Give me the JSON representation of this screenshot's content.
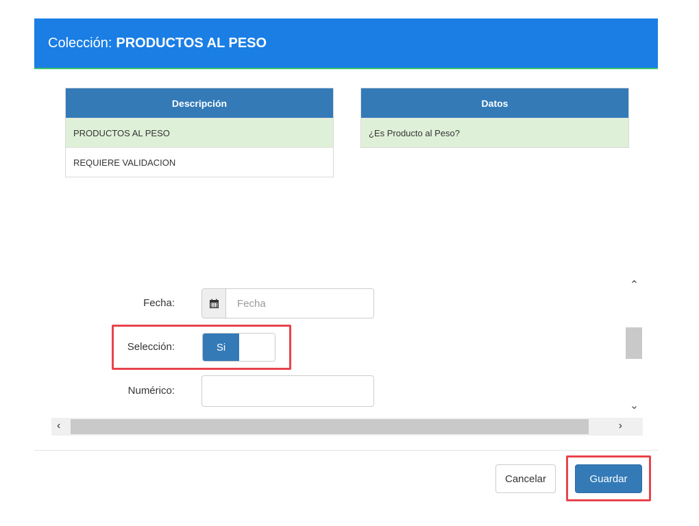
{
  "header": {
    "title_prefix": "Colección:",
    "title_name": "PRODUCTOS AL PESO"
  },
  "descripcion_grid": {
    "header": "Descripción",
    "rows": [
      "PRODUCTOS AL PESO",
      "REQUIERE VALIDACION"
    ],
    "selected_index": 0
  },
  "datos_grid": {
    "header": "Datos",
    "rows": [
      "¿Es Producto al Peso?"
    ]
  },
  "form": {
    "fecha_label": "Fecha:",
    "fecha_placeholder": "Fecha",
    "seleccion_label": "Selección:",
    "seleccion_value": "Si",
    "numerico_label": "Numérico:",
    "numerico_value": ""
  },
  "icons": {
    "calendar": "calendar-icon",
    "scroll_up": "chevron-up-icon",
    "scroll_down": "chevron-down-icon",
    "scroll_left": "chevron-left-icon",
    "scroll_right": "chevron-right-icon"
  },
  "footer": {
    "cancel_label": "Cancelar",
    "save_label": "Guardar"
  },
  "colors": {
    "header_bg": "#1a7ee5",
    "grid_header_bg": "#337ab7",
    "selected_row_bg": "#dff0d8",
    "primary_button": "#337ab7",
    "highlight_border": "#e8434a"
  }
}
